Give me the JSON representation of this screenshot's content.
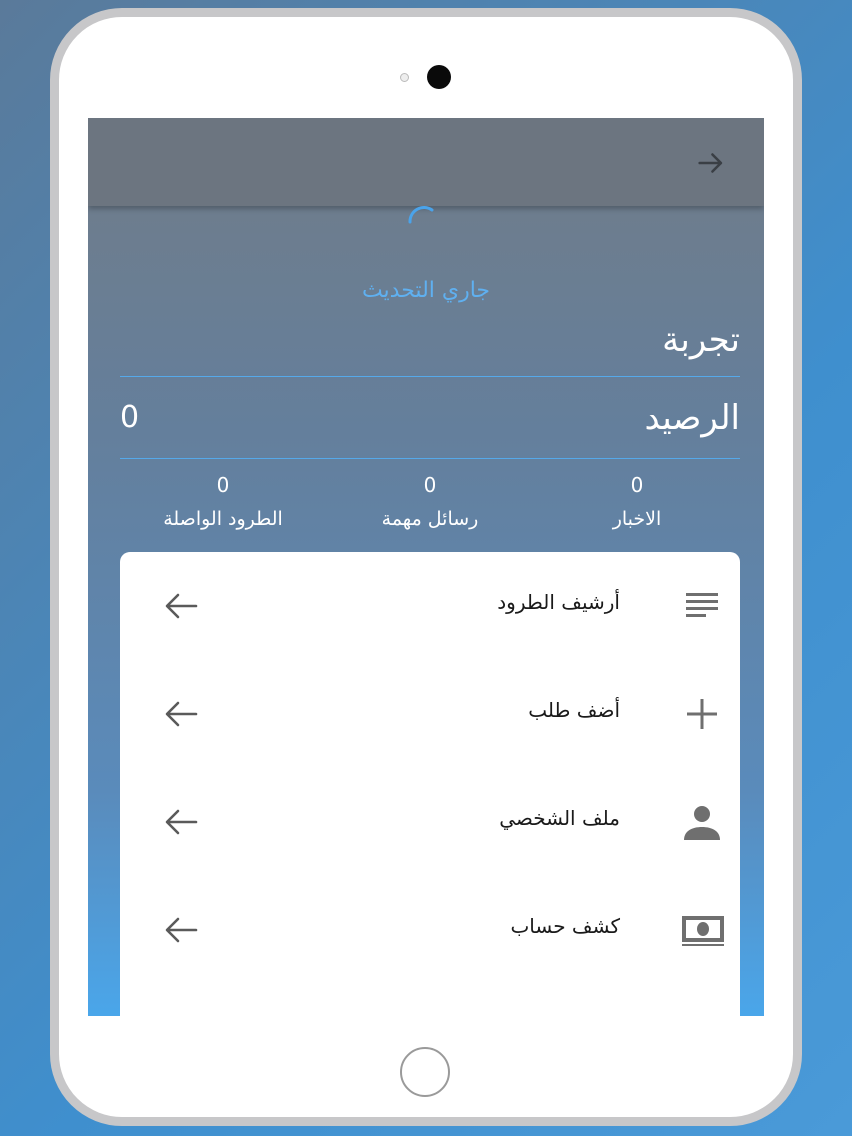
{
  "appbar": {
    "back_icon": "arrow-right-icon"
  },
  "refresh": {
    "label": "جاري التحديث"
  },
  "account": {
    "name": "تجربة"
  },
  "balance": {
    "label": "الرصيد",
    "value": "0"
  },
  "stats": [
    {
      "label": "الاخبار",
      "value": "0"
    },
    {
      "label": "رسائل مهمة",
      "value": "0"
    },
    {
      "label": "الطرود الواصلة",
      "value": "0"
    }
  ],
  "menu": [
    {
      "label": "أرشيف الطرود",
      "icon": "list-icon"
    },
    {
      "label": "أضف طلب",
      "icon": "plus-icon"
    },
    {
      "label": "ملف الشخصي",
      "icon": "person-icon"
    },
    {
      "label": "كشف حساب",
      "icon": "money-icon"
    }
  ],
  "colors": {
    "accent": "#5fb0f0",
    "appbar": "#6c7580",
    "card": "#ffffff"
  }
}
